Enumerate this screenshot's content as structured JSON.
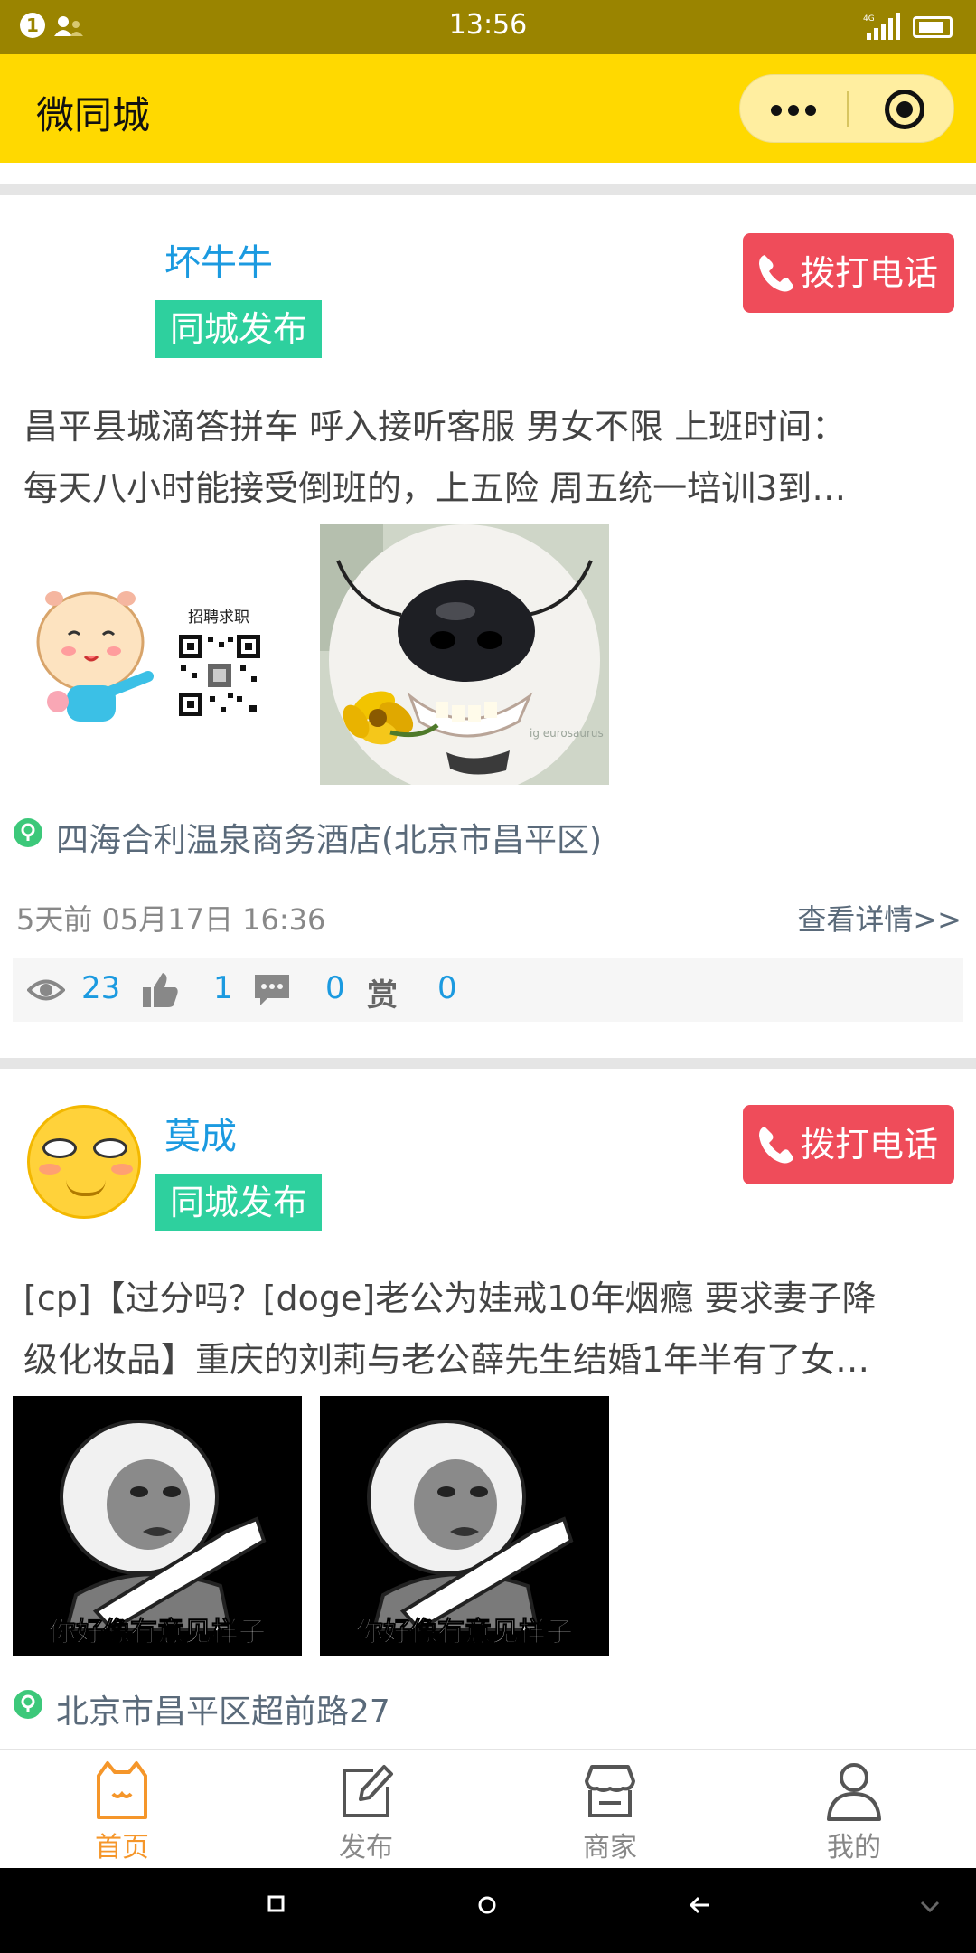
{
  "status_bar": {
    "time": "13:56",
    "notification_count": "1",
    "network": "4G"
  },
  "header": {
    "title": "微同城"
  },
  "posts": [
    {
      "username": "坏牛牛",
      "tag": "同城发布",
      "call_label": "拨打电话",
      "content_lines": [
        "昌平县城滴答拼车 呼入接听客服 男女不限 上班时间：",
        "每天八小时能接受倒班的，上五险 周五统一培训3到…"
      ],
      "image_texts": [
        "招聘求职",
        "ig eurosaurus"
      ],
      "location": "四海合利温泉商务酒店(北京市昌平区)",
      "time": "5天前 05月17日 16:36",
      "detail_link": "查看详情>>",
      "views": "23",
      "likes": "1",
      "comments": "0",
      "reward_label": "赏",
      "rewards": "0"
    },
    {
      "username": "莫成",
      "tag": "同城发布",
      "call_label": "拨打电话",
      "content_lines": [
        "[cp]【过分吗？[doge]老公为娃戒10年烟瘾 要求妻子降",
        "级化妆品】重庆的刘莉与老公薛先生结婚1年半有了女…"
      ],
      "image_texts": [
        "你好像有意见样子",
        "你好像有意见样子"
      ],
      "location": "北京市昌平区超前路27"
    }
  ],
  "tabs": [
    {
      "label": "首页",
      "icon": "home-cat-icon",
      "active": true
    },
    {
      "label": "发布",
      "icon": "edit-icon",
      "active": false
    },
    {
      "label": "商家",
      "icon": "store-icon",
      "active": false
    },
    {
      "label": "我的",
      "icon": "user-icon",
      "active": false
    }
  ],
  "colors": {
    "header": "#ffd900",
    "tag": "#2ed09e",
    "call": "#ef4c5a",
    "link": "#1b9ae0",
    "active_tab": "#f5962a"
  }
}
